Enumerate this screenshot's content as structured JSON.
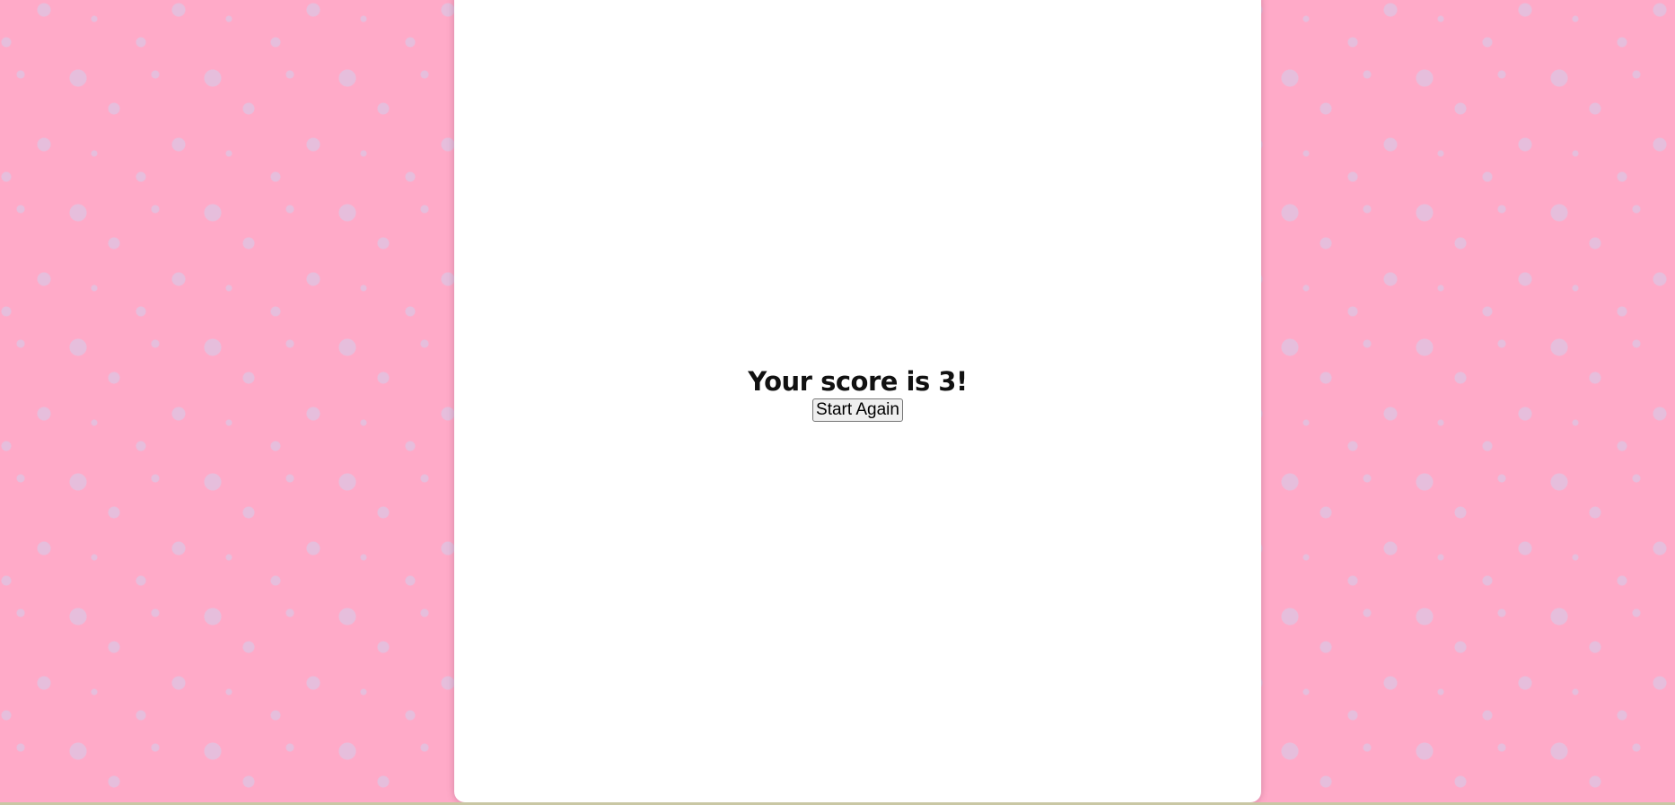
{
  "game": {
    "score_message": "Your score is 3!",
    "score": 3,
    "restart_label": "Start Again"
  },
  "colors": {
    "background": "#ffaac8",
    "dots": "#e6bedc",
    "panel": "#ffffff"
  }
}
